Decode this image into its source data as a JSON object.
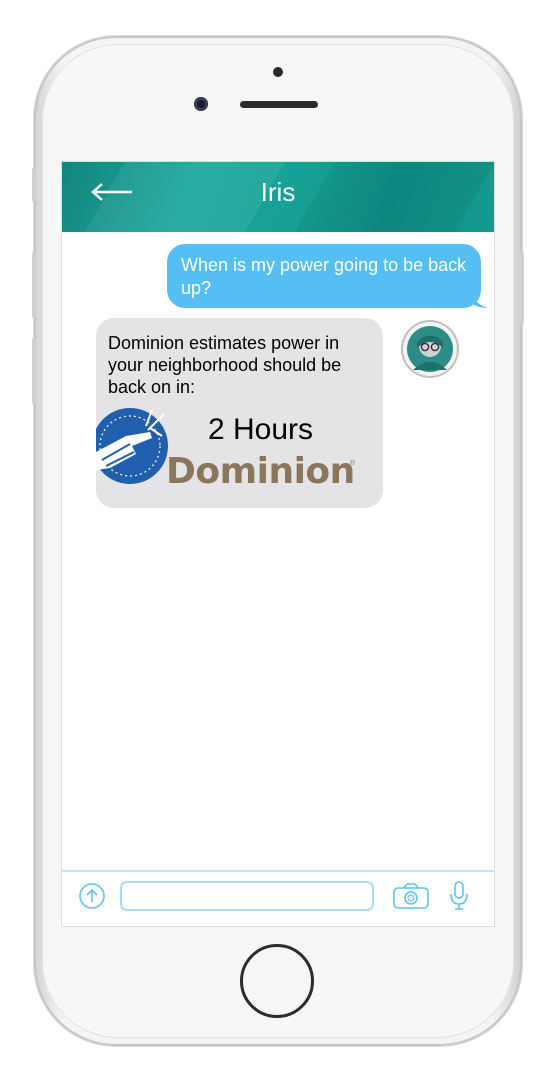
{
  "header": {
    "title": "Iris",
    "back_icon": "back-arrow-icon",
    "color": "#17a094"
  },
  "messages": {
    "user_message": "When is my power going to be back up?",
    "bot_text": "Dominion estimates power in your neighborhood should be back on in:",
    "bot_value": "2 Hours",
    "logo_text": "Dominion",
    "logo_reg": "®",
    "user_bubble_color": "#55bff4",
    "bot_bubble_color": "#e4e4e6"
  },
  "input_bar": {
    "upload_icon": "upload-arrow-icon",
    "text_value": "",
    "camera_icon": "camera-icon",
    "mic_icon": "microphone-icon",
    "accent": "#5cc4ef"
  },
  "avatar": {
    "icon": "assistant-avatar-icon"
  }
}
